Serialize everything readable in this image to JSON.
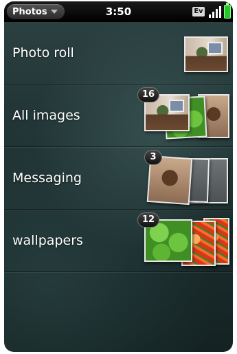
{
  "statusbar": {
    "app_menu_label": "Photos",
    "time": "3:50",
    "network_badge": "Ev",
    "icons": [
      "chevron-down-icon",
      "signal-icon",
      "battery-icon"
    ],
    "battery_color": "#29c629"
  },
  "albums": [
    {
      "label": "Photo roll",
      "count": ""
    },
    {
      "label": "All images",
      "count": "16"
    },
    {
      "label": "Messaging",
      "count": "3"
    },
    {
      "label": "wallpapers",
      "count": "12"
    }
  ]
}
